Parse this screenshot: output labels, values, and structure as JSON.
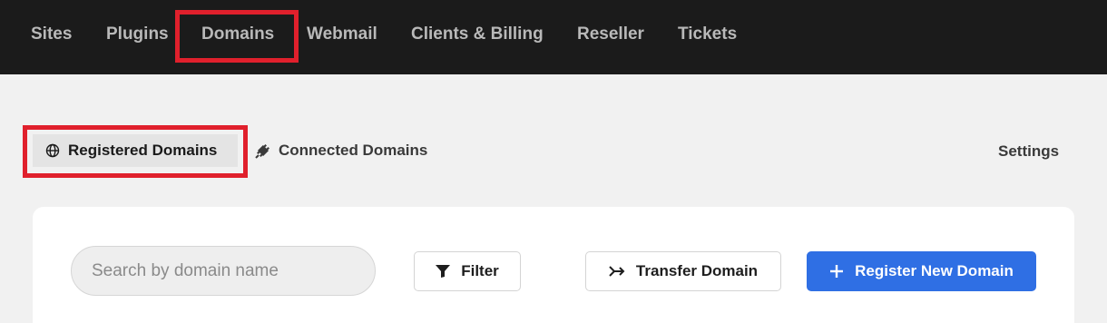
{
  "topnav": {
    "items": [
      {
        "label": "Sites"
      },
      {
        "label": "Plugins"
      },
      {
        "label": "Domains"
      },
      {
        "label": "Webmail"
      },
      {
        "label": "Clients & Billing"
      },
      {
        "label": "Reseller"
      },
      {
        "label": "Tickets"
      }
    ],
    "active": "Domains"
  },
  "subnav": {
    "registered_label": "Registered Domains",
    "registered_icon": "globe-icon",
    "connected_label": "Connected Domains",
    "connected_icon": "plug-icon",
    "settings_label": "Settings"
  },
  "toolbar": {
    "search_placeholder": "Search by domain name",
    "filter_label": "Filter",
    "filter_icon": "filter-funnel-icon",
    "transfer_label": "Transfer Domain",
    "transfer_icon": "transfer-arrow-icon",
    "register_label": "Register New Domain",
    "register_icon": "plus-icon"
  },
  "colors": {
    "topnav_bg": "#1b1b1b",
    "highlight": "#e0202c",
    "primary": "#2f6fe4"
  }
}
